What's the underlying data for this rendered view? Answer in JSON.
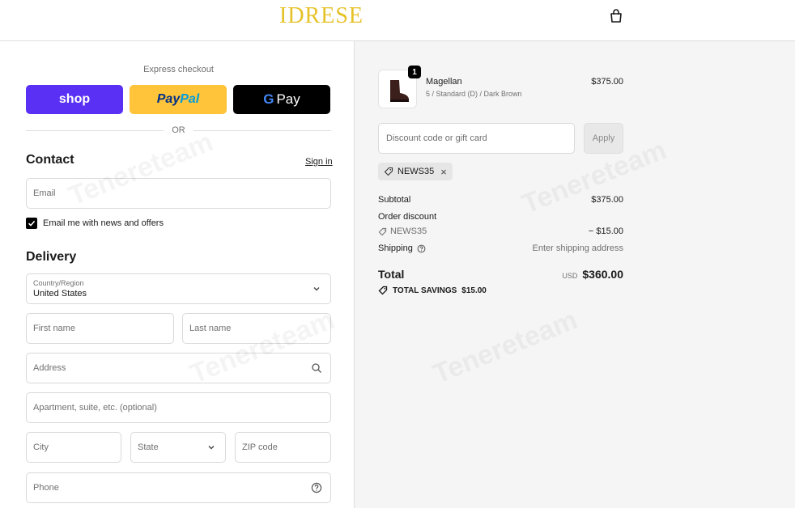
{
  "header": {
    "logo": "IDRESE",
    "bag_icon": "shopping-bag-icon"
  },
  "express": {
    "label": "Express checkout",
    "shop_label": "shop",
    "paypal_label_1": "Pay",
    "paypal_label_2": "Pal",
    "gpay_g": "G",
    "gpay_label": "Pay",
    "or_label": "OR"
  },
  "contact": {
    "title": "Contact",
    "signin": "Sign in",
    "email_placeholder": "Email",
    "newsletter_label": "Email me with news and offers",
    "newsletter_checked": true
  },
  "delivery": {
    "title": "Delivery",
    "country_label": "Country/Region",
    "country_value": "United States",
    "first_name": "First name",
    "last_name": "Last name",
    "address": "Address",
    "apartment": "Apartment, suite, etc. (optional)",
    "city": "City",
    "state": "State",
    "zip": "ZIP code",
    "phone": "Phone"
  },
  "summary": {
    "product": {
      "name": "Magellan",
      "variant": "5 / Standard (D) / Dark Brown",
      "price": "$375.00",
      "quantity": "1"
    },
    "discount_placeholder": "Discount code or gift card",
    "apply_label": "Apply",
    "applied_code": "NEWS35",
    "subtotal_label": "Subtotal",
    "subtotal_value": "$375.00",
    "order_discount_label": "Order discount",
    "discount_code": "NEWS35",
    "discount_value": "− $15.00",
    "shipping_label": "Shipping",
    "shipping_value": "Enter shipping address",
    "total_label": "Total",
    "total_currency": "USD",
    "total_value": "$360.00",
    "savings_label": "TOTAL SAVINGS",
    "savings_value": "$15.00"
  },
  "watermark": "Tenereteam",
  "colors": {
    "shop": "#5a31f4",
    "paypal": "#ffc439",
    "gpay": "#000000",
    "logo": "#e6c229"
  }
}
